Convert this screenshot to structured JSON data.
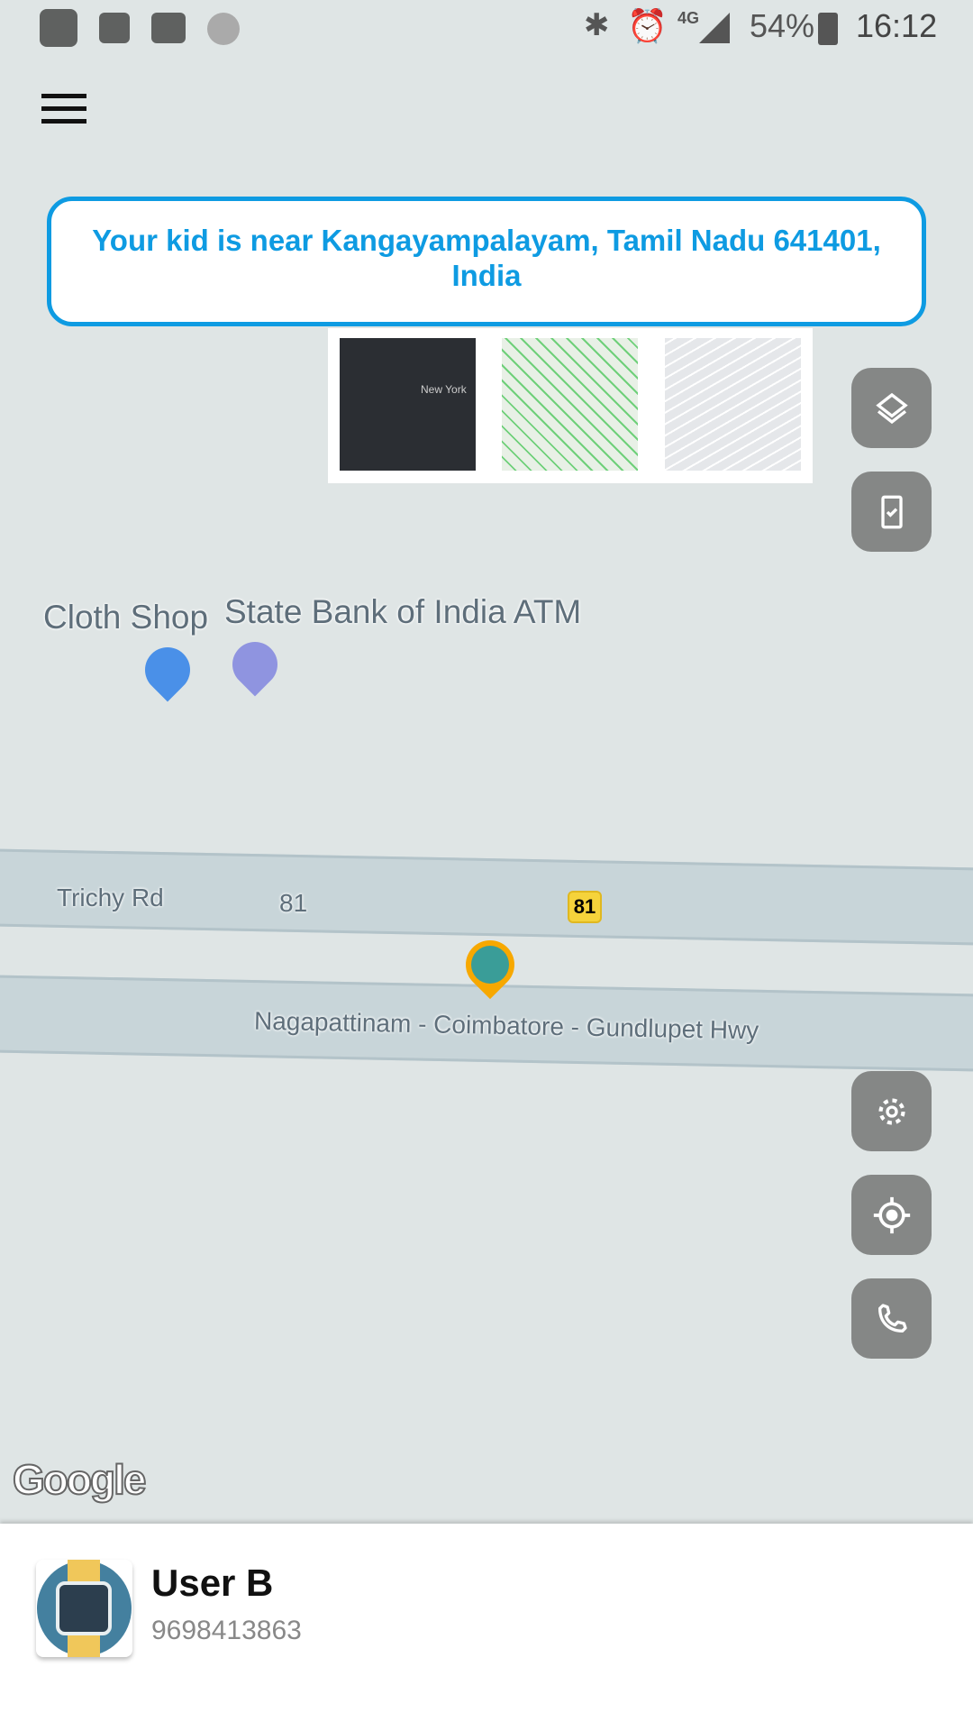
{
  "status_bar": {
    "battery": "54%",
    "time": "16:12",
    "network": "4G",
    "left_icons": [
      "mi-icon",
      "image-icon",
      "mail-check-icon",
      "loading-icon"
    ],
    "right_icons": [
      "bluetooth-icon",
      "alarm-icon",
      "signal-icon",
      "battery-charging-icon"
    ]
  },
  "banner": {
    "text": "Your kid is near Kangayampalayam, Tamil Nadu 641401, India",
    "color": "#0e9be2"
  },
  "map_types": {
    "thumb1_label": "New York"
  },
  "map": {
    "pois": [
      {
        "label": "Cloth Shop",
        "icon": "shopping-bag-icon",
        "color": "#4a90e8"
      },
      {
        "label": "State Bank of India ATM",
        "icon": "atm-icon",
        "color": "#8f94e0"
      }
    ],
    "roads": {
      "trichy": "Trichy Rd",
      "route_number": "81",
      "shield": "81",
      "highway": "Nagapattinam - Coimbatore - Gundlupet Hwy"
    },
    "attribution": "Google"
  },
  "controls": [
    "layers-icon",
    "device-check-icon",
    "gear-icon",
    "my-location-icon",
    "phone-icon"
  ],
  "user": {
    "name": "User B",
    "phone": "9698413863"
  }
}
